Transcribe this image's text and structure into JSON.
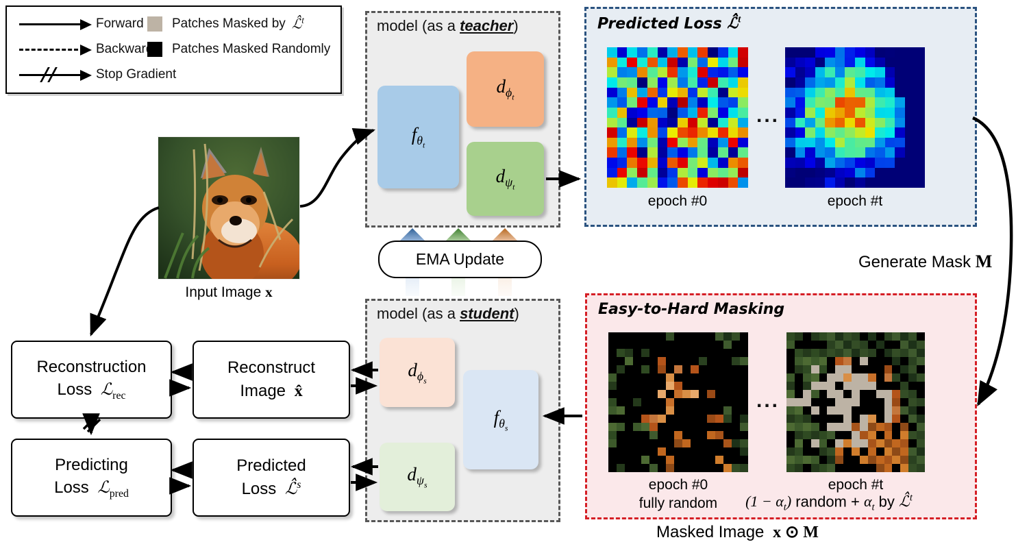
{
  "legend": {
    "rows": [
      {
        "icon": "solid-arrow-icon",
        "label": "Forward"
      },
      {
        "icon": "dashed-arrow-icon",
        "label": "Backward"
      },
      {
        "icon": "stop-gradient-arrow-icon",
        "label": "Stop Gradient"
      }
    ],
    "swatches": [
      {
        "color": "#bdb3a5",
        "label": "Patches Masked by",
        "symbol": "L̂ᵗ"
      },
      {
        "color": "#000000",
        "label": "Patches Masked Randomly",
        "symbol": ""
      }
    ]
  },
  "teacher": {
    "title_prefix": "model (as a ",
    "title_emph": "teacher",
    "title_suffix": ")",
    "modules": [
      {
        "name": "f-theta-t",
        "latex": "f",
        "sub": "θt"
      },
      {
        "name": "d-phi-t",
        "latex": "d",
        "sub": "ϕt"
      },
      {
        "name": "d-psi-t",
        "latex": "d",
        "sub": "ψt"
      }
    ]
  },
  "student": {
    "title_prefix": "model (as a ",
    "title_emph": "student",
    "title_suffix": ")",
    "modules": [
      {
        "name": "d-phi-s",
        "latex": "d",
        "sub": "ϕs"
      },
      {
        "name": "f-theta-s",
        "latex": "f",
        "sub": "θs"
      },
      {
        "name": "d-psi-s",
        "latex": "d",
        "sub": "ψs"
      }
    ]
  },
  "ema": {
    "label": "EMA Update",
    "arrow_colors": [
      "#2e5f95",
      "#3a7d2c",
      "#b5651d"
    ]
  },
  "input": {
    "caption": "Input Image",
    "symbol": "x"
  },
  "loss_panel": {
    "title": "Predicted Loss",
    "title_symbol": "ℒ̂ᵗ",
    "border_color": "#2b5380",
    "fill_color": "#e7edf3",
    "items": [
      {
        "caption": "epoch #0"
      },
      {
        "caption": "epoch #t"
      }
    ],
    "ellipsis": "..."
  },
  "mask_panel": {
    "title": "Easy-to-Hard Masking",
    "border_color": "#d51f26",
    "fill_color": "#fbe8ea",
    "items": [
      {
        "caption": "epoch #0",
        "sub_caption": "fully random"
      },
      {
        "caption": "epoch #t",
        "sub_caption": "(1 − αt) random + αt by L̂ᵗ"
      }
    ],
    "ellipsis": "..."
  },
  "generate_mask_label": "Generate Mask",
  "generate_mask_symbol": "M",
  "masked_image_label": "Masked Image",
  "masked_image_symbol": "x ⊙ M",
  "boxes": {
    "rec_loss": {
      "line1": "Reconstruction",
      "line2_prefix": "Loss",
      "line2_symbol": "ℒrec"
    },
    "rec_img": {
      "line1": "Reconstruct",
      "line2_prefix": "Image",
      "line2_symbol": "x̂"
    },
    "pred_loss_left": {
      "line1": "Predicting",
      "line2_prefix": "Loss",
      "line2_symbol": "ℒpred"
    },
    "pred_loss_student": {
      "line1": "Predicted",
      "line2_prefix": "Loss",
      "line2_symbol": "ℒ̂s"
    }
  },
  "colors": {
    "teacher_fill": "#ededed",
    "f_blue": "#a8cbe8",
    "d_orange": "#f5b184",
    "d_green": "#a8d08d",
    "f_blue_light": "#dae6f4",
    "d_orange_light": "#fbe2d5",
    "d_green_light": "#e3efda",
    "mask_gray_patch": "#bdb3a5"
  }
}
